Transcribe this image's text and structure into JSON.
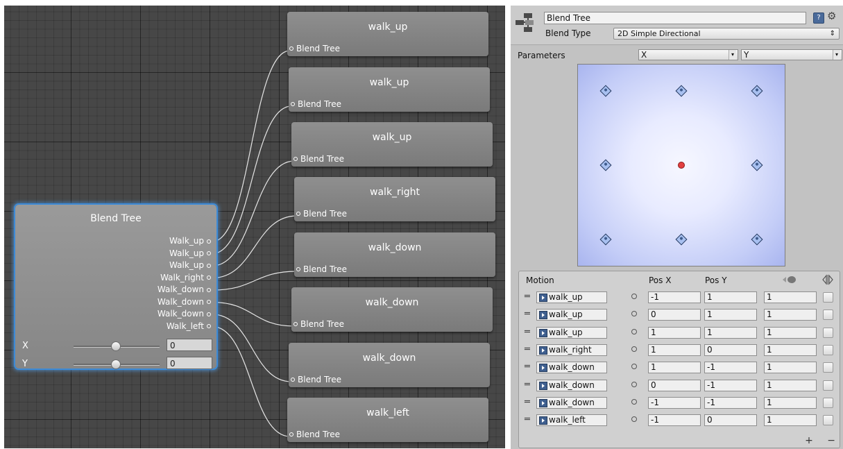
{
  "graph": {
    "blend_node": {
      "title": "Blend Tree",
      "outputs": [
        "Walk_up",
        "Walk_up",
        "Walk_up",
        "Walk_right",
        "Walk_down",
        "Walk_down",
        "Walk_down",
        "Walk_left"
      ],
      "params": [
        {
          "label": "X",
          "value": "0"
        },
        {
          "label": "Y",
          "value": "0"
        }
      ]
    },
    "motion_nodes": [
      {
        "title": "walk_up",
        "port": "Blend Tree"
      },
      {
        "title": "walk_up",
        "port": "Blend Tree"
      },
      {
        "title": "walk_up",
        "port": "Blend Tree"
      },
      {
        "title": "walk_right",
        "port": "Blend Tree"
      },
      {
        "title": "walk_down",
        "port": "Blend Tree"
      },
      {
        "title": "walk_down",
        "port": "Blend Tree"
      },
      {
        "title": "walk_down",
        "port": "Blend Tree"
      },
      {
        "title": "walk_left",
        "port": "Blend Tree"
      }
    ]
  },
  "inspector": {
    "name": "Blend Tree",
    "blend_type_label": "Blend Type",
    "blend_type_value": "2D Simple Directional",
    "parameters_label": "Parameters",
    "param_x": "X",
    "param_y": "Y",
    "blend_points": [
      {
        "x": -1,
        "y": 1
      },
      {
        "x": 0,
        "y": 1
      },
      {
        "x": 1,
        "y": 1
      },
      {
        "x": -1,
        "y": 0
      },
      {
        "x": 1,
        "y": 0
      },
      {
        "x": -1,
        "y": -1
      },
      {
        "x": 0,
        "y": -1
      },
      {
        "x": 1,
        "y": -1
      }
    ],
    "current_point": {
      "x": 0,
      "y": 0
    },
    "table": {
      "headers": {
        "motion": "Motion",
        "posx": "Pos X",
        "posy": "Pos Y"
      },
      "rows": [
        {
          "clip": "walk_up",
          "posx": "-1",
          "posy": "1",
          "speed": "1"
        },
        {
          "clip": "walk_up",
          "posx": "0",
          "posy": "1",
          "speed": "1"
        },
        {
          "clip": "walk_up",
          "posx": "1",
          "posy": "1",
          "speed": "1"
        },
        {
          "clip": "walk_right",
          "posx": "1",
          "posy": "0",
          "speed": "1"
        },
        {
          "clip": "walk_down",
          "posx": "1",
          "posy": "-1",
          "speed": "1"
        },
        {
          "clip": "walk_down",
          "posx": "0",
          "posy": "-1",
          "speed": "1"
        },
        {
          "clip": "walk_down",
          "posx": "-1",
          "posy": "-1",
          "speed": "1"
        },
        {
          "clip": "walk_left",
          "posx": "-1",
          "posy": "0",
          "speed": "1"
        }
      ],
      "add_label": "+",
      "remove_label": "−"
    }
  }
}
